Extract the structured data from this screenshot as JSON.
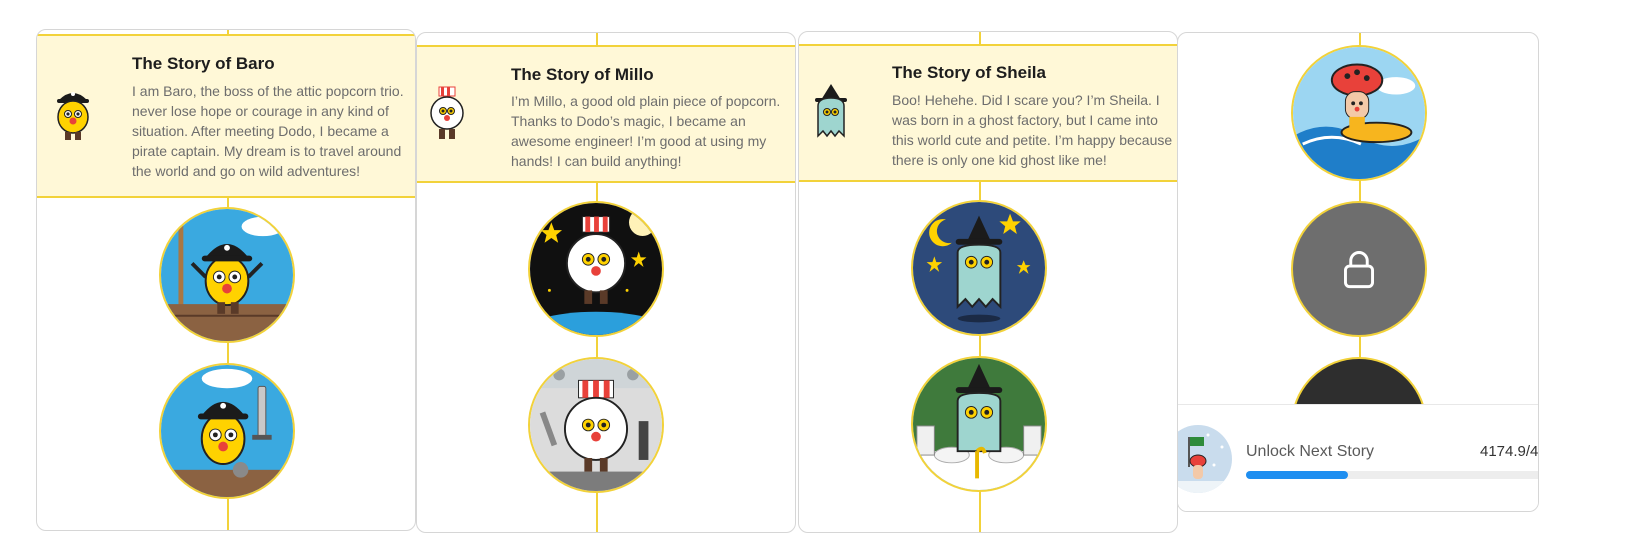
{
  "stories": [
    {
      "title": "The Story of Baro",
      "description": [
        "I am Baro, the boss of the attic popcorn trio.",
        "never lose hope or courage in any kind of",
        "situation. After meeting Dodo, I became a",
        "pirate captain. My dream is to travel around",
        "the world and go on wild adventures!"
      ]
    },
    {
      "title": "The Story of Millo",
      "description": [
        "I’m Millo, a good old plain piece of popcorn.",
        "Thanks to Dodo’s magic, I became an",
        "awesome engineer! I’m good at using my",
        "hands! I can build anything!"
      ]
    },
    {
      "title": "The Story of Sheila",
      "description": [
        "Boo! Hehehe. Did I scare you? I’m Sheila. I",
        "was born in a ghost factory, but I came into",
        "this world cute and petite. I’m happy because",
        "there is only one kid ghost like me!"
      ]
    }
  ],
  "unlock": {
    "label": "Unlock Next Story",
    "value": "4174.9/4",
    "progress": 0.34
  },
  "colors": {
    "accent_yellow": "#f2d23a",
    "header_bg": "#fff8d7",
    "progress_blue": "#1e8ef0"
  },
  "icons": {
    "lock": "lock-icon"
  }
}
